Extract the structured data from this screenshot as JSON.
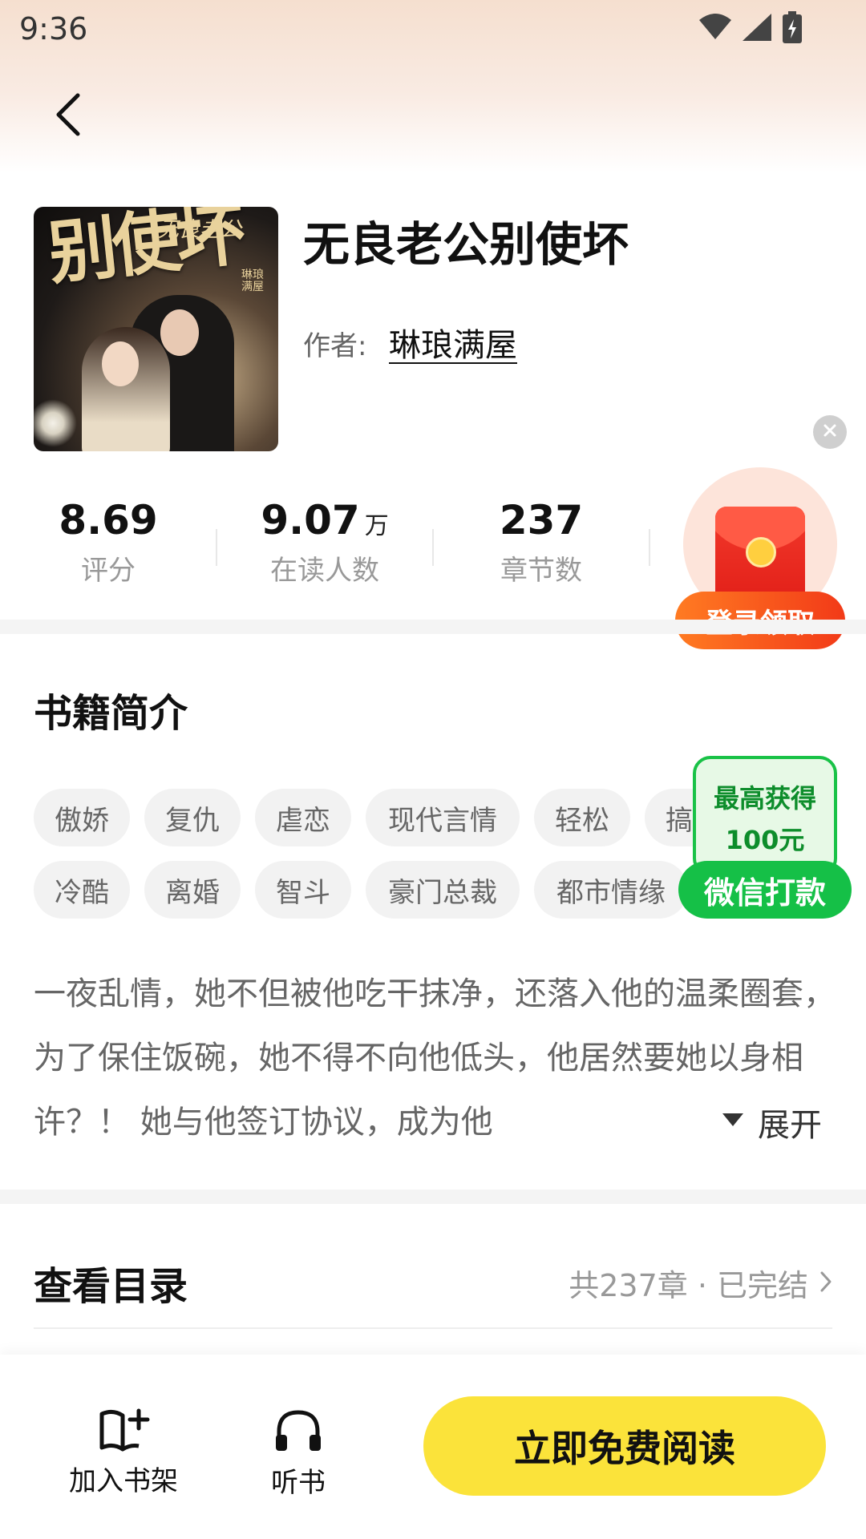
{
  "status_bar": {
    "time": "9:36"
  },
  "book": {
    "title": "无良老公别使坏",
    "author_label": "作者:",
    "author_name": "琳琅满屋",
    "cover": {
      "title_text": "别使坏",
      "subtitle_text": "无良老公",
      "author_text": "琳琅满屋"
    }
  },
  "stats": [
    {
      "value": "8.69",
      "unit": "",
      "label": "评分"
    },
    {
      "value": "9.07",
      "unit": "万",
      "label": "在读人数"
    },
    {
      "value": "237",
      "unit": "",
      "label": "章节数"
    }
  ],
  "promo_red": {
    "button_label": "登录领取"
  },
  "promo_green": {
    "line1": "最高获得",
    "line2": "100元",
    "button_label": "微信打款"
  },
  "intro": {
    "section_title": "书籍简介",
    "tags_row1": [
      "傲娇",
      "复仇",
      "虐恋",
      "现代言情",
      "轻松",
      "搞"
    ],
    "tags_row2": [
      "冷酷",
      "离婚",
      "智斗",
      "豪门总裁",
      "都市情缘"
    ],
    "summary": "一夜乱情，她不但被他吃干抹净，还落入他的温柔圈套，为了保住饭碗，她不得不向他低头，他居然要她以身相许？！ 她与他签订协议，成为他",
    "expand_label": "展开"
  },
  "toc": {
    "title": "查看目录",
    "meta": "共237章 · 已完结"
  },
  "bottom_bar": {
    "add_shelf_label": "加入书架",
    "listen_label": "听书",
    "read_button_label": "立即免费阅读"
  },
  "colors": {
    "read_button": "#fbe33a",
    "promo_red": "#f23a18",
    "promo_green": "#15c047"
  }
}
